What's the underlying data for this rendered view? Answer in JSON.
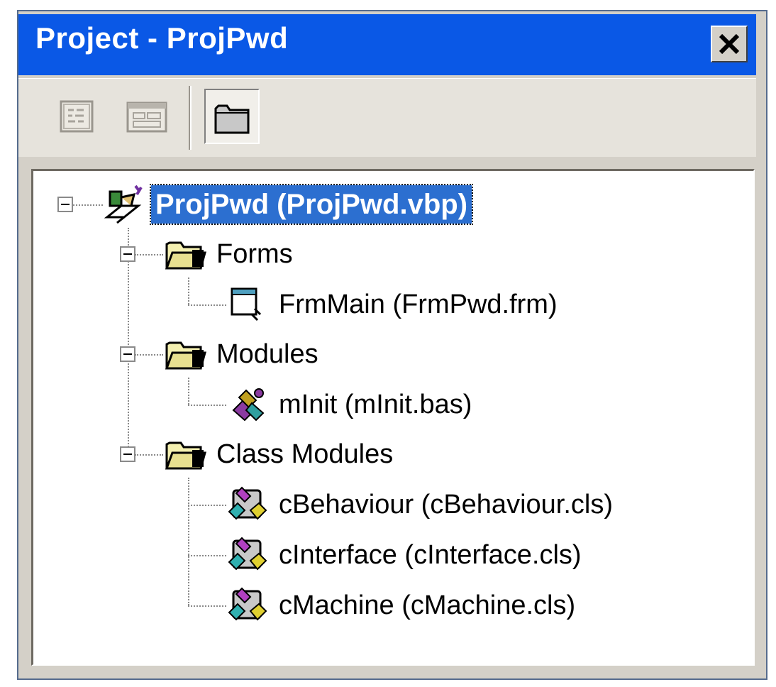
{
  "window": {
    "title": "Project - ProjPwd",
    "close_label": "×"
  },
  "toolbar": {
    "buttons": [
      {
        "name": "view-code",
        "icon": "view-code-icon"
      },
      {
        "name": "view-object",
        "icon": "view-object-icon"
      },
      {
        "name": "toggle-folders",
        "icon": "folder-icon",
        "pressed": true
      }
    ]
  },
  "tree": {
    "root": {
      "label": "ProjPwd (ProjPwd.vbp)",
      "icon": "project-icon",
      "selected": true
    },
    "groups": [
      {
        "label": "Forms",
        "icon": "open-folder-icon",
        "items": [
          {
            "label": "FrmMain (FrmPwd.frm)",
            "icon": "form-icon"
          }
        ]
      },
      {
        "label": "Modules",
        "icon": "open-folder-icon",
        "items": [
          {
            "label": "mInit (mInit.bas)",
            "icon": "module-icon"
          }
        ]
      },
      {
        "label": "Class Modules",
        "icon": "open-folder-icon",
        "items": [
          {
            "label": "cBehaviour (cBehaviour.cls)",
            "icon": "class-module-icon"
          },
          {
            "label": "cInterface (cInterface.cls)",
            "icon": "class-module-icon"
          },
          {
            "label": "cMachine (cMachine.cls)",
            "icon": "class-module-icon"
          }
        ]
      }
    ]
  },
  "colors": {
    "titlebar": "#0a58e6",
    "selection": "#2c6fd0",
    "window_face": "#d4d0c8"
  }
}
